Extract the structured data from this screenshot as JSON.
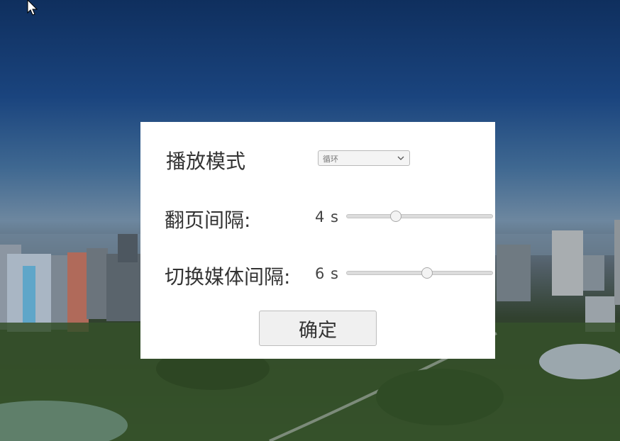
{
  "dialog": {
    "play_mode": {
      "label": "播放模式",
      "selected": "循环"
    },
    "page_interval": {
      "label": "翻页间隔:",
      "value_text": "4 s",
      "fraction": 0.34
    },
    "media_interval": {
      "label": "切换媒体间隔:",
      "value_text": "6 s",
      "fraction": 0.55
    },
    "confirm_label": "确定"
  },
  "icons": [
    "mouse-cursor-icon",
    "chevron-down-icon"
  ],
  "colors": {
    "dialog_bg": "#ffffff",
    "text": "#333333",
    "sky": "#1a447e"
  }
}
